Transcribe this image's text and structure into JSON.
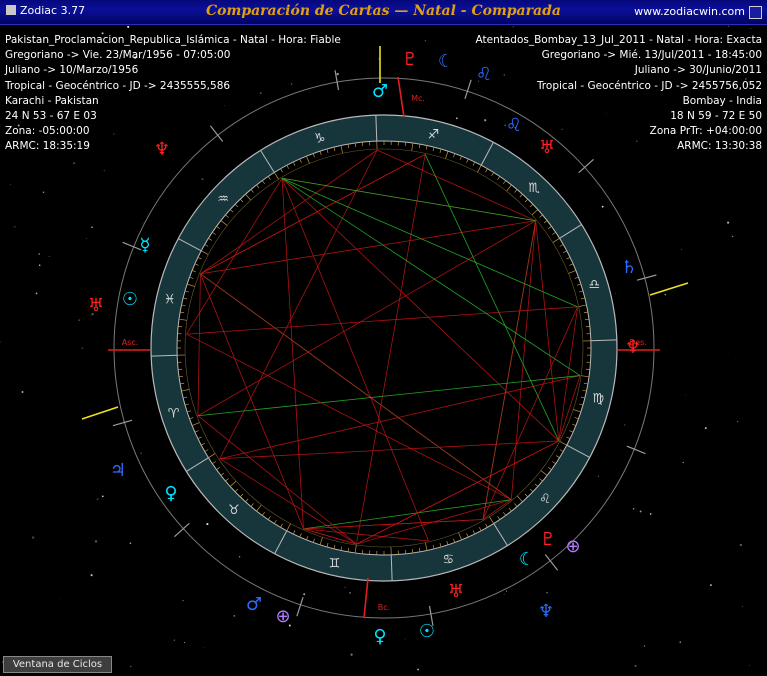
{
  "window": {
    "app_name": "Zodiac 3.77",
    "title": "Comparación de Cartas — Natal - Comparada",
    "website": "www.zodiacwin.com"
  },
  "natal": {
    "name_line": "Pakistan_Proclamacion_Republica_Islámica - Natal - Hora: Fiable",
    "gregorian": "Gregoriano -> Vie. 23/Mar/1956 - 07:05:00",
    "julian": "Juliano -> 10/Marzo/1956",
    "mode": "Tropical - Geocéntrico - JD -> 2435555,586",
    "place": "Karachi - Pakistan",
    "coords": "24 N 53 - 67 E 03",
    "zone": "Zona: -05:00:00",
    "armc": "ARMC: 18:35:19"
  },
  "transit": {
    "name_line": "Atentados_Bombay_13_Jul_2011 - Natal - Hora: Exacta",
    "gregorian": "Gregoriano -> Mié. 13/Jul/2011 - 18:45:00",
    "julian": "Juliano -> 30/Junio/2011",
    "mode": "Tropical - Geocéntrico - JD -> 2455756,052",
    "place": "Bombay - India",
    "coords": "18 N 59 - 72 E 50",
    "zone": "Zona PrTr: +04:00:00",
    "armc": "ARMC: 13:30:38"
  },
  "angles": {
    "asc": "Asc.",
    "des": "Des.",
    "mc": "Mc.",
    "ic": "Bc."
  },
  "zodiac_signs": [
    "♈",
    "♉",
    "♊",
    "♋",
    "♌",
    "♍",
    "♎",
    "♏",
    "♐",
    "♑",
    "♒",
    "♓"
  ],
  "outer_planets": [
    {
      "symbol": "♇",
      "color": "#ff2020"
    },
    {
      "symbol": "☾",
      "color": "#2b6cff"
    },
    {
      "symbol": "♌",
      "color": "#2b6cff"
    },
    {
      "symbol": "♂",
      "color": "#00e5ff"
    },
    {
      "symbol": "♌",
      "color": "#2b6cff"
    },
    {
      "symbol": "♅",
      "color": "#ff2020"
    },
    {
      "symbol": "♆",
      "color": "#ff2020"
    },
    {
      "symbol": "♄",
      "color": "#2b6cff"
    },
    {
      "symbol": "⊕",
      "color": "#b07cff"
    },
    {
      "symbol": "♇",
      "color": "#ff2020"
    },
    {
      "symbol": "☾",
      "color": "#00e5ff"
    },
    {
      "symbol": "♆",
      "color": "#2b6cff"
    },
    {
      "symbol": "♅",
      "color": "#ff2020"
    },
    {
      "symbol": "☉",
      "color": "#00e5ff"
    },
    {
      "symbol": "♀",
      "color": "#00e5ff"
    },
    {
      "symbol": "⊕",
      "color": "#b07cff"
    },
    {
      "symbol": "♂",
      "color": "#2b6cff"
    },
    {
      "symbol": "♀",
      "color": "#00e5ff"
    },
    {
      "symbol": "♃",
      "color": "#2b6cff"
    },
    {
      "symbol": "♅",
      "color": "#ff2020"
    },
    {
      "symbol": "☉",
      "color": "#00e5ff"
    },
    {
      "symbol": "☿",
      "color": "#00e5ff"
    },
    {
      "symbol": "♆",
      "color": "#ff2020"
    }
  ],
  "buttons": {
    "cycles": "Ventana de Ciclos"
  },
  "colors": {
    "ring_fill": "#17363c",
    "gold": "#c79a34",
    "red_aspect": "#c01515",
    "green_aspect": "#28b828"
  }
}
